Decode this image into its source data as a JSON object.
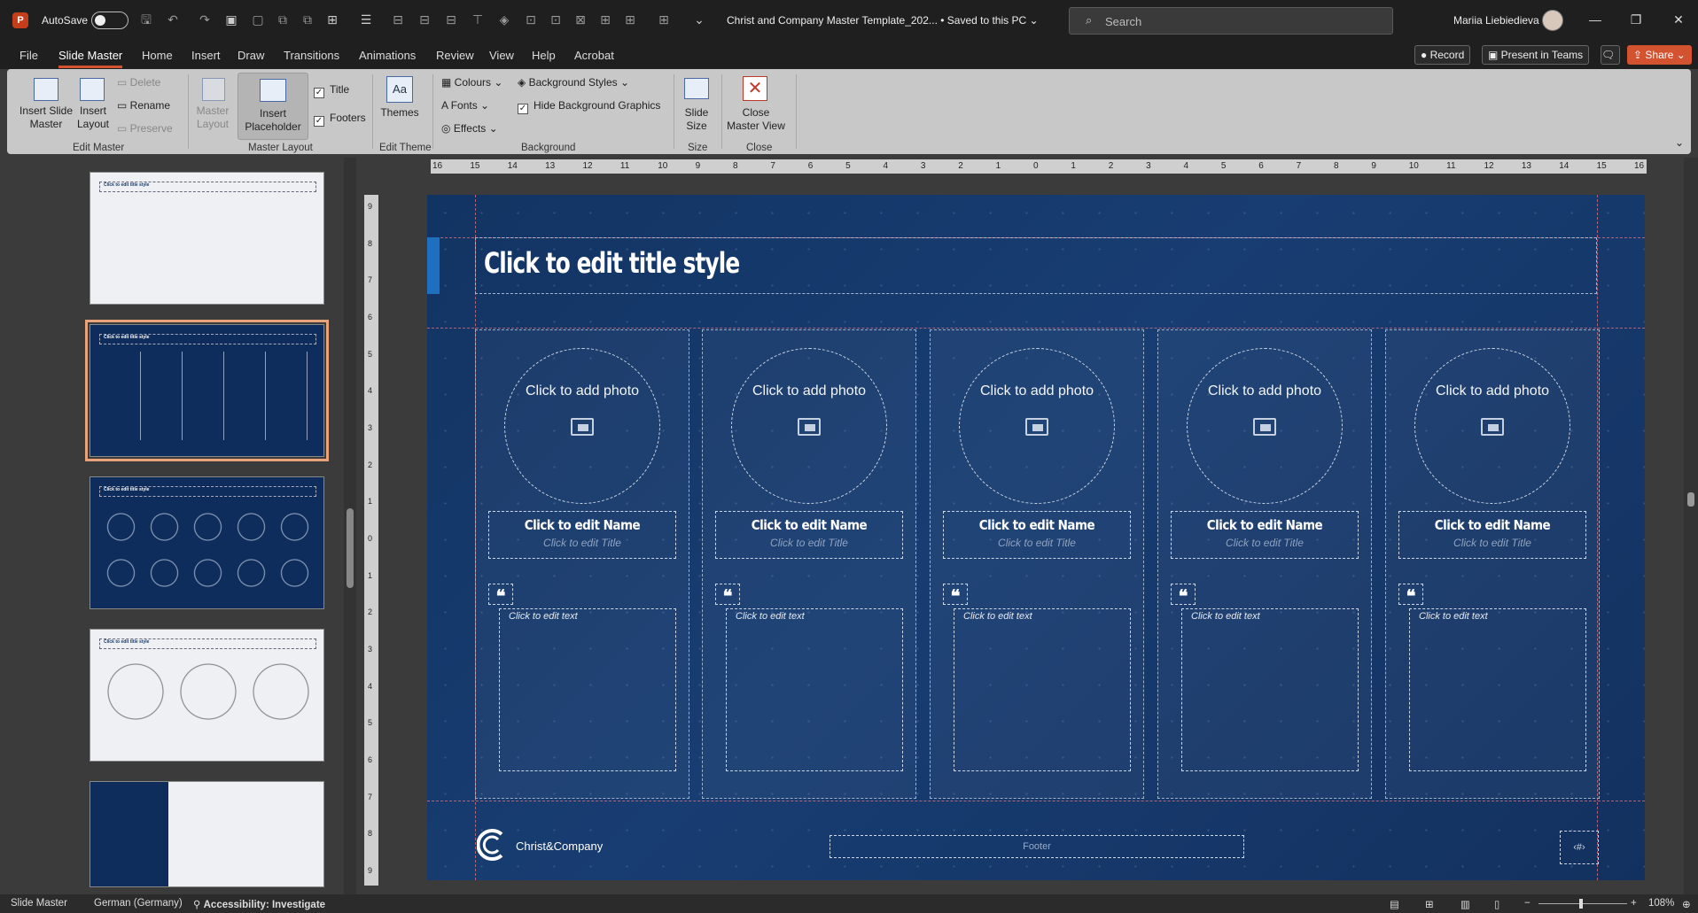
{
  "app": {
    "logo_letter": "P"
  },
  "titlebar": {
    "autosave_label": "AutoSave",
    "autosave_on": false,
    "document_title": "Christ and Company Master Template_202... • Saved to this PC ⌄",
    "search_placeholder": "Search",
    "user_name": "Mariia Liebiedieva"
  },
  "tabs": [
    "File",
    "Slide Master",
    "Home",
    "Insert",
    "Draw",
    "Transitions",
    "Animations",
    "Review",
    "View",
    "Help",
    "Acrobat"
  ],
  "active_tab": "Slide Master",
  "header_buttons": {
    "record": "Record",
    "present_teams": "Present in Teams",
    "share": "Share"
  },
  "ribbon": {
    "insert_slide_master": "Insert Slide Master",
    "insert_layout": "Insert Layout",
    "delete": "Delete",
    "rename": "Rename",
    "preserve": "Preserve",
    "group_edit_master": "Edit Master",
    "master_layout": "Master Layout",
    "insert_placeholder": "Insert Placeholder",
    "title_check": "Title",
    "footers_check": "Footers",
    "group_master_layout": "Master Layout",
    "themes": "Themes",
    "group_edit_theme": "Edit Theme",
    "colours": "Colours",
    "fonts": "Fonts",
    "effects": "Effects",
    "background_styles": "Background Styles",
    "hide_background_graphics": "Hide Background Graphics",
    "group_background": "Background",
    "slide_size": "Slide Size",
    "group_size": "Size",
    "close_master_view": "Close Master View",
    "group_close": "Close"
  },
  "ruler_ticks_h": [
    "16",
    "15",
    "14",
    "13",
    "12",
    "11",
    "10",
    "9",
    "8",
    "7",
    "6",
    "5",
    "4",
    "3",
    "2",
    "1",
    "0",
    "1",
    "2",
    "3",
    "4",
    "5",
    "6",
    "7",
    "8",
    "9",
    "10",
    "11",
    "12",
    "13",
    "14",
    "15",
    "16"
  ],
  "ruler_ticks_v": [
    "9",
    "8",
    "7",
    "6",
    "5",
    "4",
    "3",
    "2",
    "1",
    "0",
    "1",
    "2",
    "3",
    "4",
    "5",
    "6",
    "7",
    "8",
    "9"
  ],
  "slide": {
    "title": "Click to edit title style",
    "columns": [
      {
        "photo": "Click to add photo",
        "name": "Click to edit Name",
        "person_title": "Click to edit Title",
        "quote_mark": "❝",
        "text": "Click to edit text"
      },
      {
        "photo": "Click to add photo",
        "name": "Click to edit Name",
        "person_title": "Click to edit Title",
        "quote_mark": "❝",
        "text": "Click to edit text"
      },
      {
        "photo": "Click to add photo",
        "name": "Click to edit Name",
        "person_title": "Click to edit Title",
        "quote_mark": "❝",
        "text": "Click to edit text"
      },
      {
        "photo": "Click to add photo",
        "name": "Click to edit Name",
        "person_title": "Click to edit Title",
        "quote_mark": "❝",
        "text": "Click to edit text"
      },
      {
        "photo": "Click to add photo",
        "name": "Click to edit Name",
        "person_title": "Click to edit Title",
        "quote_mark": "❝",
        "text": "Click to edit text"
      }
    ],
    "logo_text": "Christ&Company",
    "footer": "Footer",
    "slide_number": "‹#›"
  },
  "status": {
    "view": "Slide Master",
    "language": "German (Germany)",
    "accessibility": "Accessibility: Investigate",
    "zoom": "108%"
  },
  "colors": {
    "accent": "#d35230",
    "slide_bg": "#123463",
    "title_accent": "#1f6fc1"
  }
}
